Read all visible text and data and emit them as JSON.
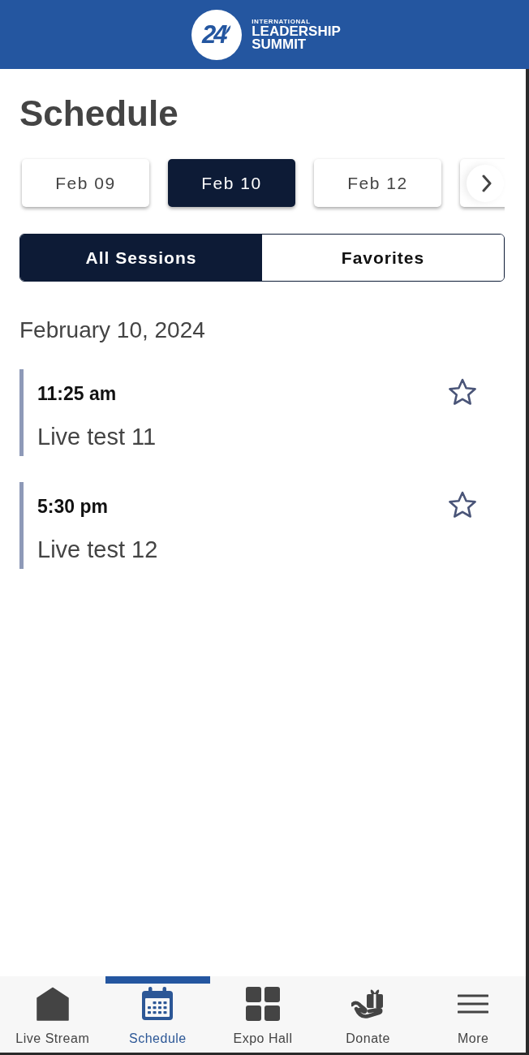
{
  "header": {
    "logo": {
      "number": "24",
      "line_small": "INTERNATIONAL",
      "line_1": "LEADERSHIP",
      "line_2": "SUMMIT"
    }
  },
  "page": {
    "title": "Schedule"
  },
  "date_tabs": [
    {
      "label": "Feb 09",
      "selected": false
    },
    {
      "label": "Feb 10",
      "selected": true
    },
    {
      "label": "Feb 12",
      "selected": false
    },
    {
      "selected": false
    }
  ],
  "filter_tabs": [
    {
      "label": "All Sessions",
      "selected": true
    },
    {
      "label": "Favorites",
      "selected": false
    }
  ],
  "date_heading": "February 10, 2024",
  "sessions": [
    {
      "time": "11:25 am",
      "title": "Live test 11",
      "favorite": false
    },
    {
      "time": "5:30 pm",
      "title": "Live test 12",
      "favorite": false
    }
  ],
  "bottom_nav": [
    {
      "kind": "home",
      "label": "Live Stream",
      "selected": false
    },
    {
      "kind": "calendar",
      "label": "Schedule",
      "selected": true
    },
    {
      "kind": "grid",
      "label": "Expo Hall",
      "selected": false
    },
    {
      "kind": "donate",
      "label": "Donate",
      "selected": false
    },
    {
      "kind": "menu",
      "label": "More",
      "selected": false
    }
  ]
}
